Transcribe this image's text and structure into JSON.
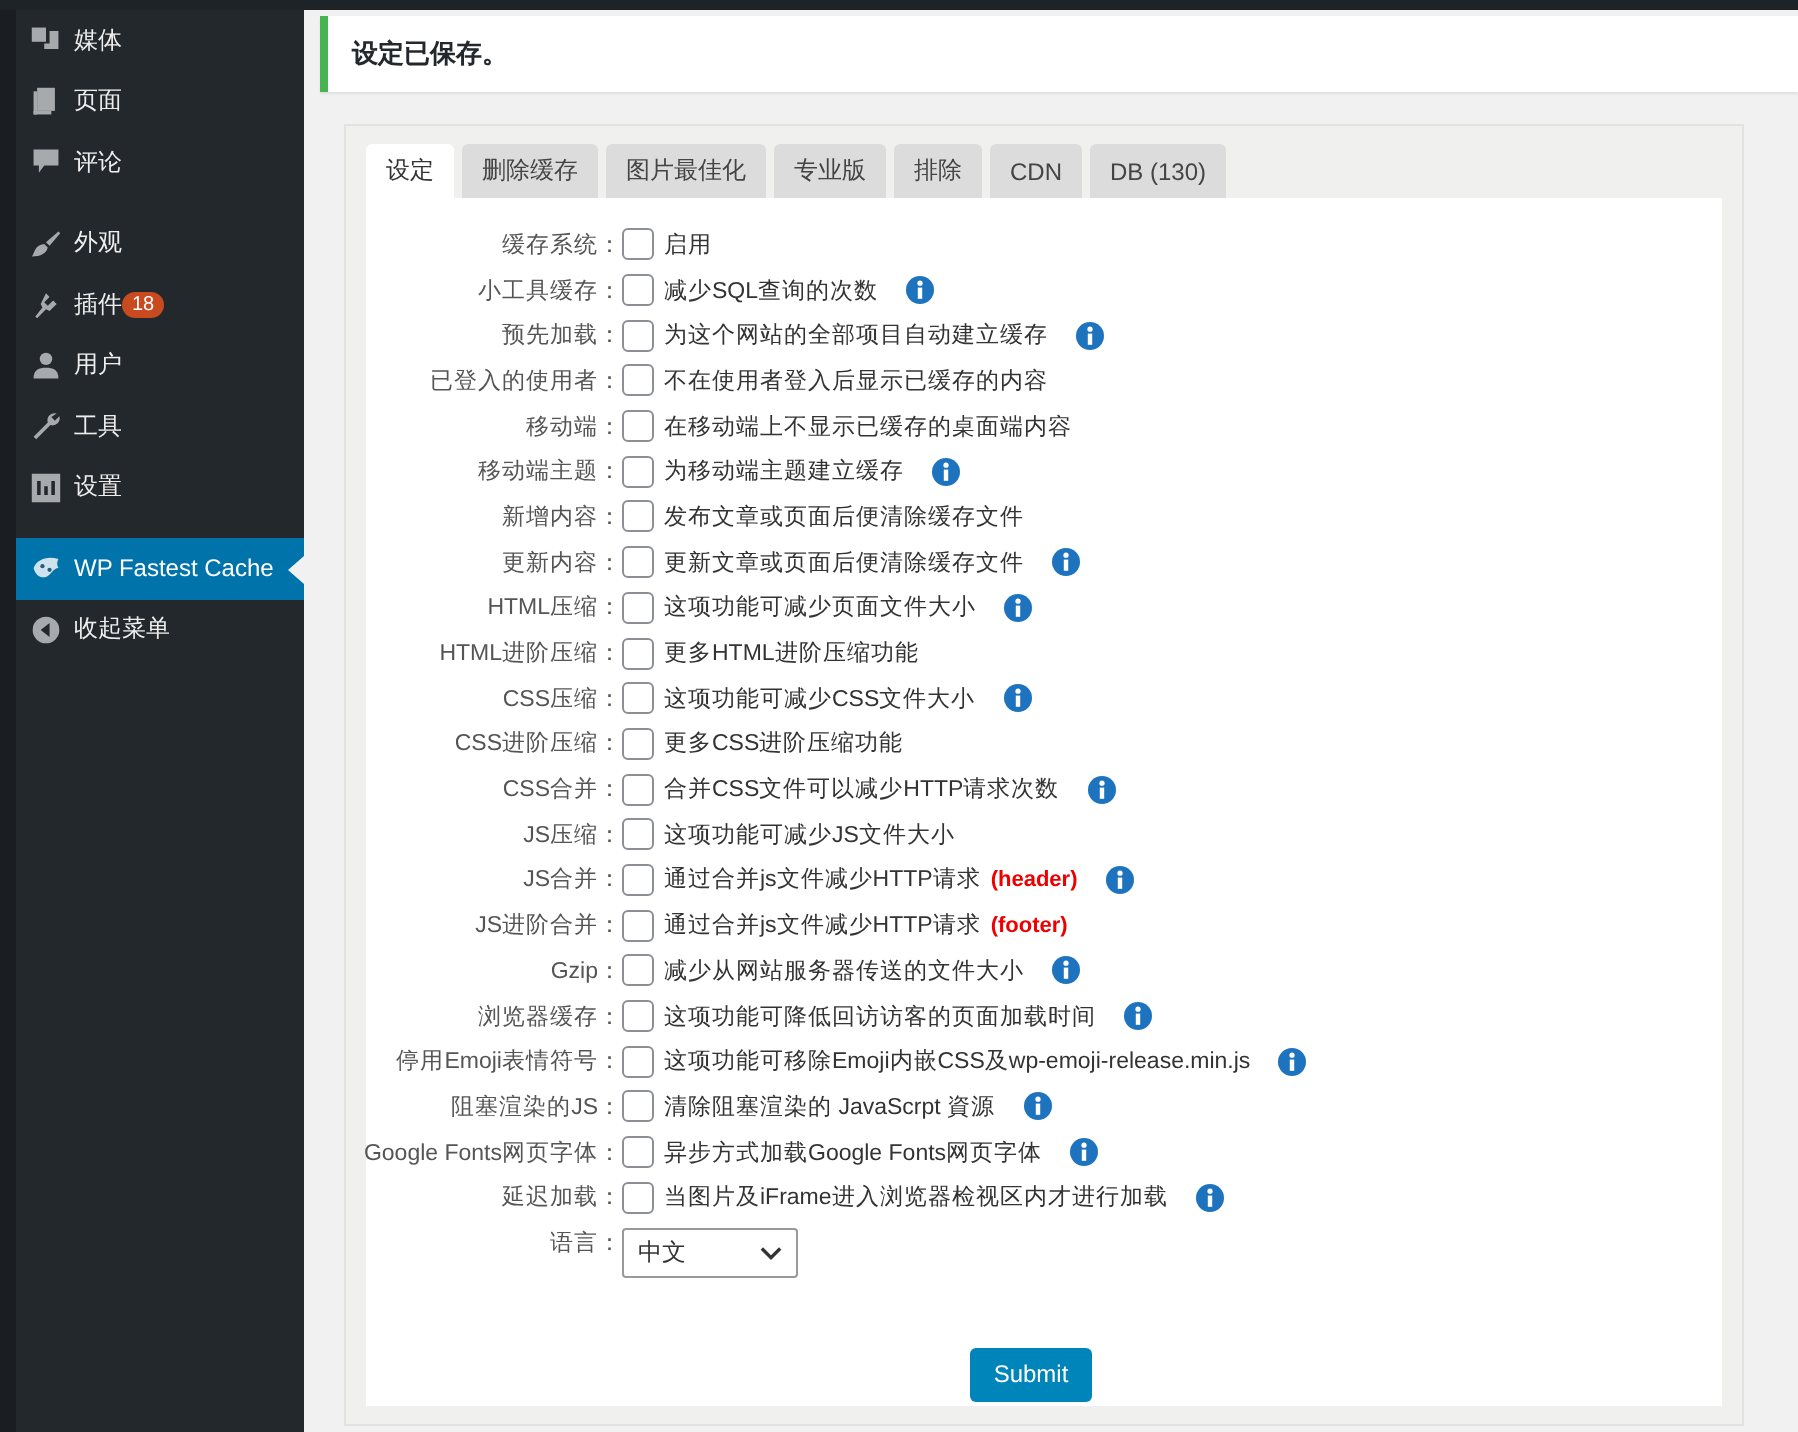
{
  "sidebar": {
    "groups": [
      {
        "items": [
          {
            "label": "媒体",
            "selected": false
          },
          {
            "label": "页面",
            "selected": false
          },
          {
            "label": "评论",
            "selected": false
          }
        ]
      },
      {
        "items": [
          {
            "label": "外观",
            "selected": false
          },
          {
            "label": "插件",
            "selected": false,
            "badge": "18"
          },
          {
            "label": "用户",
            "selected": false
          },
          {
            "label": "工具",
            "selected": false
          },
          {
            "label": "设置",
            "selected": false
          }
        ]
      },
      {
        "items": [
          {
            "label": "WP Fastest Cache",
            "selected": true
          },
          {
            "label": "收起菜单",
            "selected": false
          }
        ]
      }
    ]
  },
  "notice": {
    "text": "设定已保存。"
  },
  "tabs": [
    {
      "label": "设定",
      "selected": true
    },
    {
      "label": "删除缓存",
      "selected": false
    },
    {
      "label": "图片最佳化",
      "selected": false
    },
    {
      "label": "专业版",
      "selected": false
    },
    {
      "label": "排除",
      "selected": false
    },
    {
      "label": "CDN",
      "selected": false
    },
    {
      "label": "DB (130)",
      "selected": false
    }
  ],
  "settings": [
    {
      "kind": "checkbox",
      "label": "缓存系统：",
      "checked": false,
      "text": "启用"
    },
    {
      "kind": "checkbox_help",
      "label": "小工具缓存：",
      "checked": false,
      "text": "减少SQL查询的次数"
    },
    {
      "kind": "checkbox_help",
      "label": "预先加载：",
      "checked": false,
      "text": "为这个网站的全部项目自动建立缓存"
    },
    {
      "kind": "checkbox",
      "label": "已登入的使用者：",
      "checked": false,
      "text": "不在使用者登入后显示已缓存的内容"
    },
    {
      "kind": "checkbox",
      "label": "移动端：",
      "checked": false,
      "text": "在移动端上不显示已缓存的桌面端内容"
    },
    {
      "kind": "checkbox_help",
      "label": "移动端主题：",
      "checked": false,
      "text": "为移动端主题建立缓存"
    },
    {
      "kind": "checkbox",
      "label": "新增内容：",
      "checked": false,
      "text": "发布文章或页面后便清除缓存文件"
    },
    {
      "kind": "checkbox_help",
      "label": "更新内容：",
      "checked": false,
      "text": "更新文章或页面后便清除缓存文件"
    },
    {
      "kind": "checkbox_help",
      "label": "HTML压缩：",
      "checked": false,
      "text": "这项功能可减少页面文件大小"
    },
    {
      "kind": "checkbox",
      "label": "HTML进阶压缩：",
      "checked": false,
      "text": "更多HTML进阶压缩功能"
    },
    {
      "kind": "checkbox_help",
      "label": "CSS压缩：",
      "checked": false,
      "text": "这项功能可减少CSS文件大小"
    },
    {
      "kind": "checkbox",
      "label": "CSS进阶压缩：",
      "checked": false,
      "text": "更多CSS进阶压缩功能"
    },
    {
      "kind": "checkbox_help",
      "label": "CSS合并：",
      "checked": false,
      "text": "合并CSS文件可以减少HTTP请求次数"
    },
    {
      "kind": "checkbox",
      "label": "JS压缩：",
      "checked": false,
      "text": "这项功能可减少JS文件大小"
    },
    {
      "kind": "checkbox_help",
      "label": "JS合并：",
      "checked": false,
      "text": "通过合并js文件减少HTTP请求",
      "tag": "(header)"
    },
    {
      "kind": "checkbox",
      "label": "JS进阶合并：",
      "checked": false,
      "text": "通过合并js文件减少HTTP请求",
      "tag": "(footer)"
    },
    {
      "kind": "checkbox_help",
      "label": "Gzip：",
      "checked": false,
      "text": "减少从网站服务器传送的文件大小"
    },
    {
      "kind": "checkbox_help",
      "label": "浏览器缓存：",
      "checked": false,
      "text": "这项功能可降低回访访客的页面加载时间"
    },
    {
      "kind": "checkbox_help",
      "label": "停用Emoji表情符号：",
      "checked": false,
      "text": "这项功能可移除Emoji内嵌CSS及wp-emoji-release.min.js"
    },
    {
      "kind": "checkbox_help",
      "label": "阻塞渲染的JS：",
      "checked": false,
      "text": "清除阻塞渲染的 JavaScrpt 資源"
    },
    {
      "kind": "checkbox_help",
      "label": "Google Fonts网页字体：",
      "checked": false,
      "text": "异步方式加载Google Fonts网页字体"
    },
    {
      "kind": "checkbox_help",
      "label": "延迟加载：",
      "checked": false,
      "text": "当图片及iFrame进入浏览器检视区内才进行加载"
    },
    {
      "kind": "select",
      "label": "语言：",
      "value": "中文"
    }
  ],
  "submit": "Submit"
}
